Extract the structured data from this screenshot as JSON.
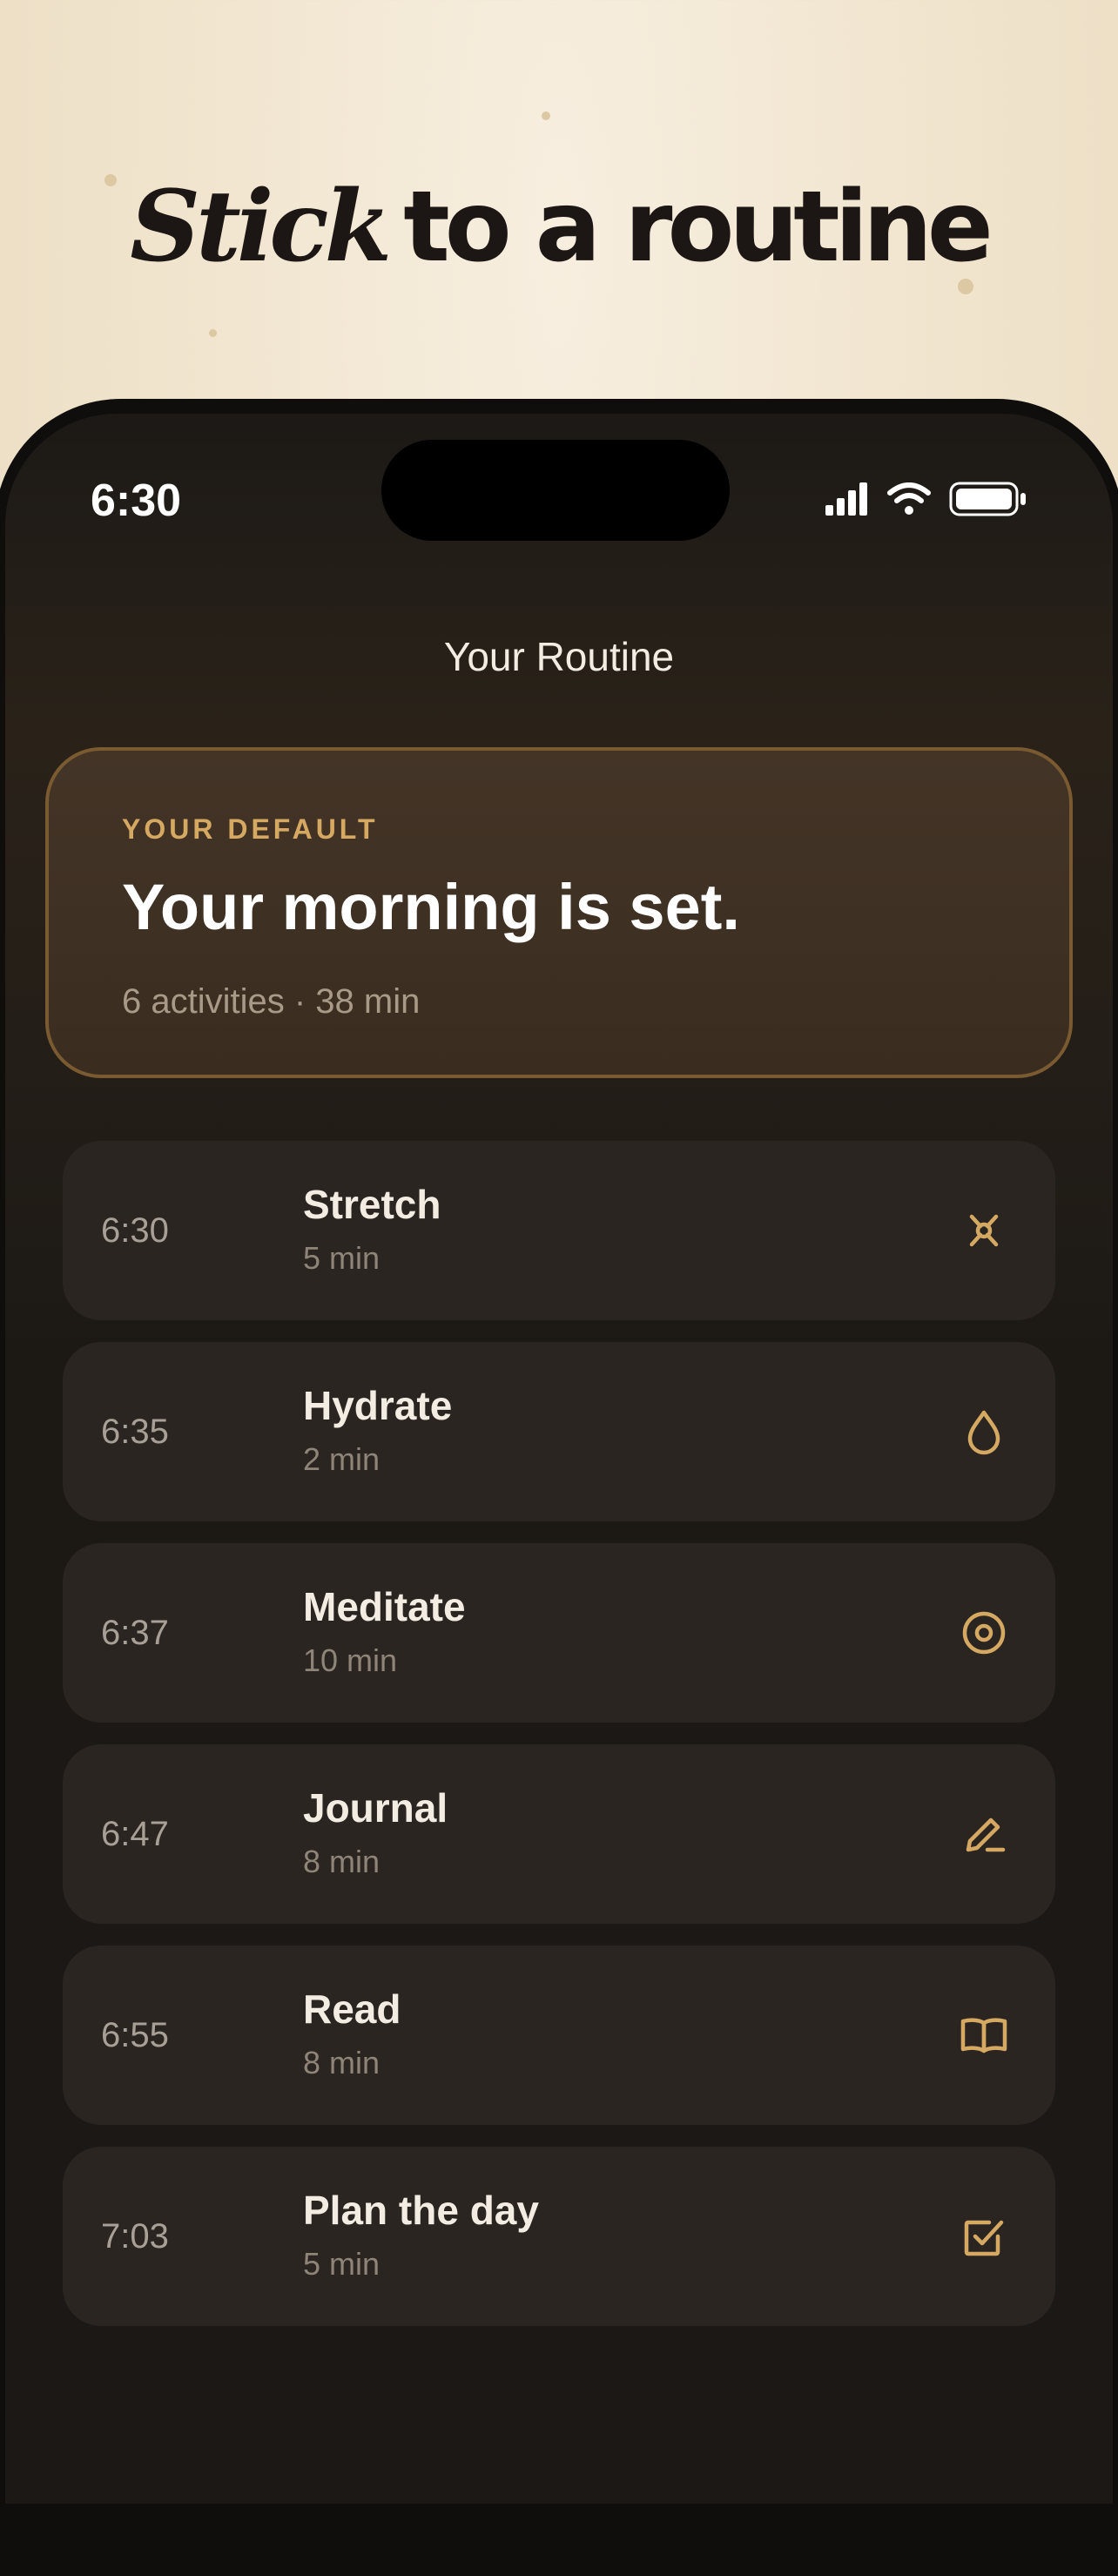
{
  "promo": {
    "headline_emphasis": "Stick",
    "headline_rest": "to a routine"
  },
  "status_bar": {
    "time": "6:30",
    "signal_icon": "cellular-signal-icon",
    "wifi_icon": "wifi-icon",
    "battery_icon": "battery-icon"
  },
  "header": {
    "title": "Your Routine"
  },
  "default_card": {
    "kicker": "YOUR DEFAULT",
    "title": "Your morning is set.",
    "summary": "6 activities · 38 min"
  },
  "activities": [
    {
      "time": "6:30",
      "name": "Stretch",
      "duration": "5 min",
      "icon": "stretch-icon"
    },
    {
      "time": "6:35",
      "name": "Hydrate",
      "duration": "2 min",
      "icon": "water-drop-icon"
    },
    {
      "time": "6:37",
      "name": "Meditate",
      "duration": "10 min",
      "icon": "target-circle-icon"
    },
    {
      "time": "6:47",
      "name": "Journal",
      "duration": "8 min",
      "icon": "pencil-icon"
    },
    {
      "time": "6:55",
      "name": "Read",
      "duration": "8 min",
      "icon": "open-book-icon"
    },
    {
      "time": "7:03",
      "name": "Plan the day",
      "duration": "5 min",
      "icon": "checkbox-icon"
    }
  ],
  "colors": {
    "accent": "#d6a962",
    "background": "#1b1815",
    "card": "#2a2521",
    "promo_background": "#f3e8d4"
  }
}
